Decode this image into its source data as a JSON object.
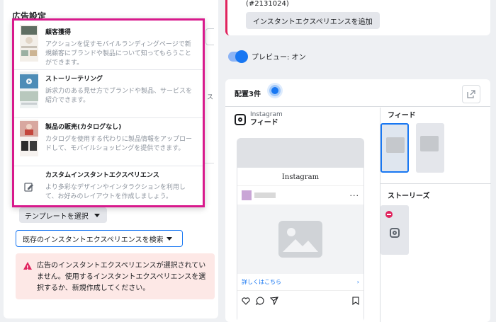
{
  "left": {
    "title": "広告設定",
    "template_button": "テンプレートを選択",
    "search_button": "既存のインスタントエクスペリエンスを検索",
    "error": "広告のインスタントエクスペリエンスが選択されていません。使用するインスタントエクスペリエンスを選択するか、新規作成してください。",
    "ghost_text": "ス"
  },
  "dropdown": {
    "items": [
      {
        "title": "顧客獲得",
        "desc": "アクションを促すモバイルランディングページで新規顧客にブランドや製品について知ってもらうことができます。",
        "icon": "customer-acquisition-thumbnail"
      },
      {
        "title": "ストーリーテリング",
        "desc": "訴求力のある見せ方でブランドや製品、サービスを紹介できます。",
        "icon": "storytelling-thumbnail"
      },
      {
        "title": "製品の販売(カタログなし)",
        "desc": "カタログを使用する代わりに製品情報をアップロードして、モバイルショッピングを提供できます。",
        "icon": "sell-products-thumbnail"
      },
      {
        "title": "カスタムインスタントエクスペリエンス",
        "desc": "より多彩なデザインやインタラクションを利用して、お好みのレイアウトを作成しましょう。",
        "icon": "pencil-icon"
      }
    ]
  },
  "right_top": {
    "id_text": "(#2131024)",
    "add_button": "インスタントエクスペリエンスを追加"
  },
  "preview": {
    "label": "プレビュー: オン",
    "state": "on"
  },
  "placements": {
    "title": "配置3件",
    "instagram": {
      "name": "Instagram",
      "sub": "フィード",
      "wordmark": "Instagram",
      "more_link": "詳しくはこちら",
      "more_arrow": "›",
      "dots": "···"
    },
    "feed_label": "フィード",
    "stories_label": "ストーリーズ"
  },
  "colors": {
    "accent": "#1877f2",
    "highlight": "#d8198c",
    "error": "#e0245e",
    "error_bg": "#fde8e6"
  }
}
